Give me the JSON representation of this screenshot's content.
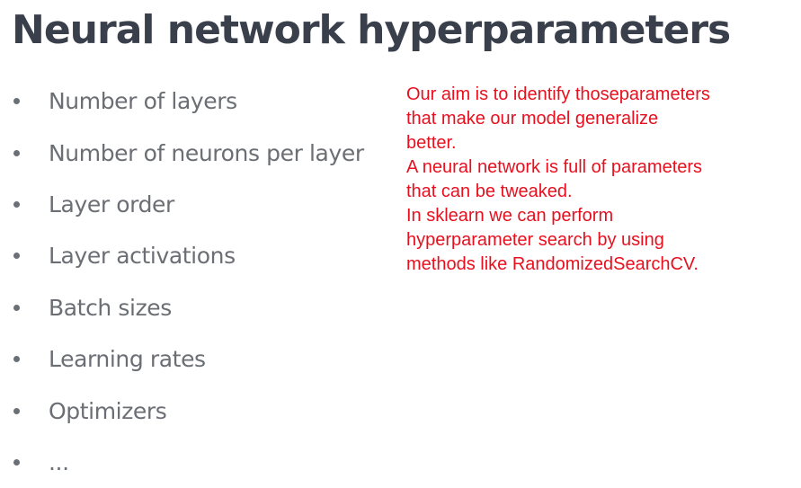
{
  "slide": {
    "title": "Neural network hyperparameters",
    "bullets": [
      "Number of layers",
      "Number of neurons per layer",
      "Layer order",
      "Layer activations",
      "Batch sizes",
      "Learning rates",
      "Optimizers",
      "..."
    ],
    "notes": [
      "Our aim is to identify thoseparameters",
      "that make our model generalize",
      "better.",
      "A neural network is full of parameters",
      "that can be tweaked.",
      "In sklearn we can perform",
      "hyperparameter search by using",
      "methods like RandomizedSearchCV."
    ]
  },
  "colors": {
    "title": "#3a3f4c",
    "bullet_text": "#6b6e74",
    "notes_text": "#e8101f"
  }
}
